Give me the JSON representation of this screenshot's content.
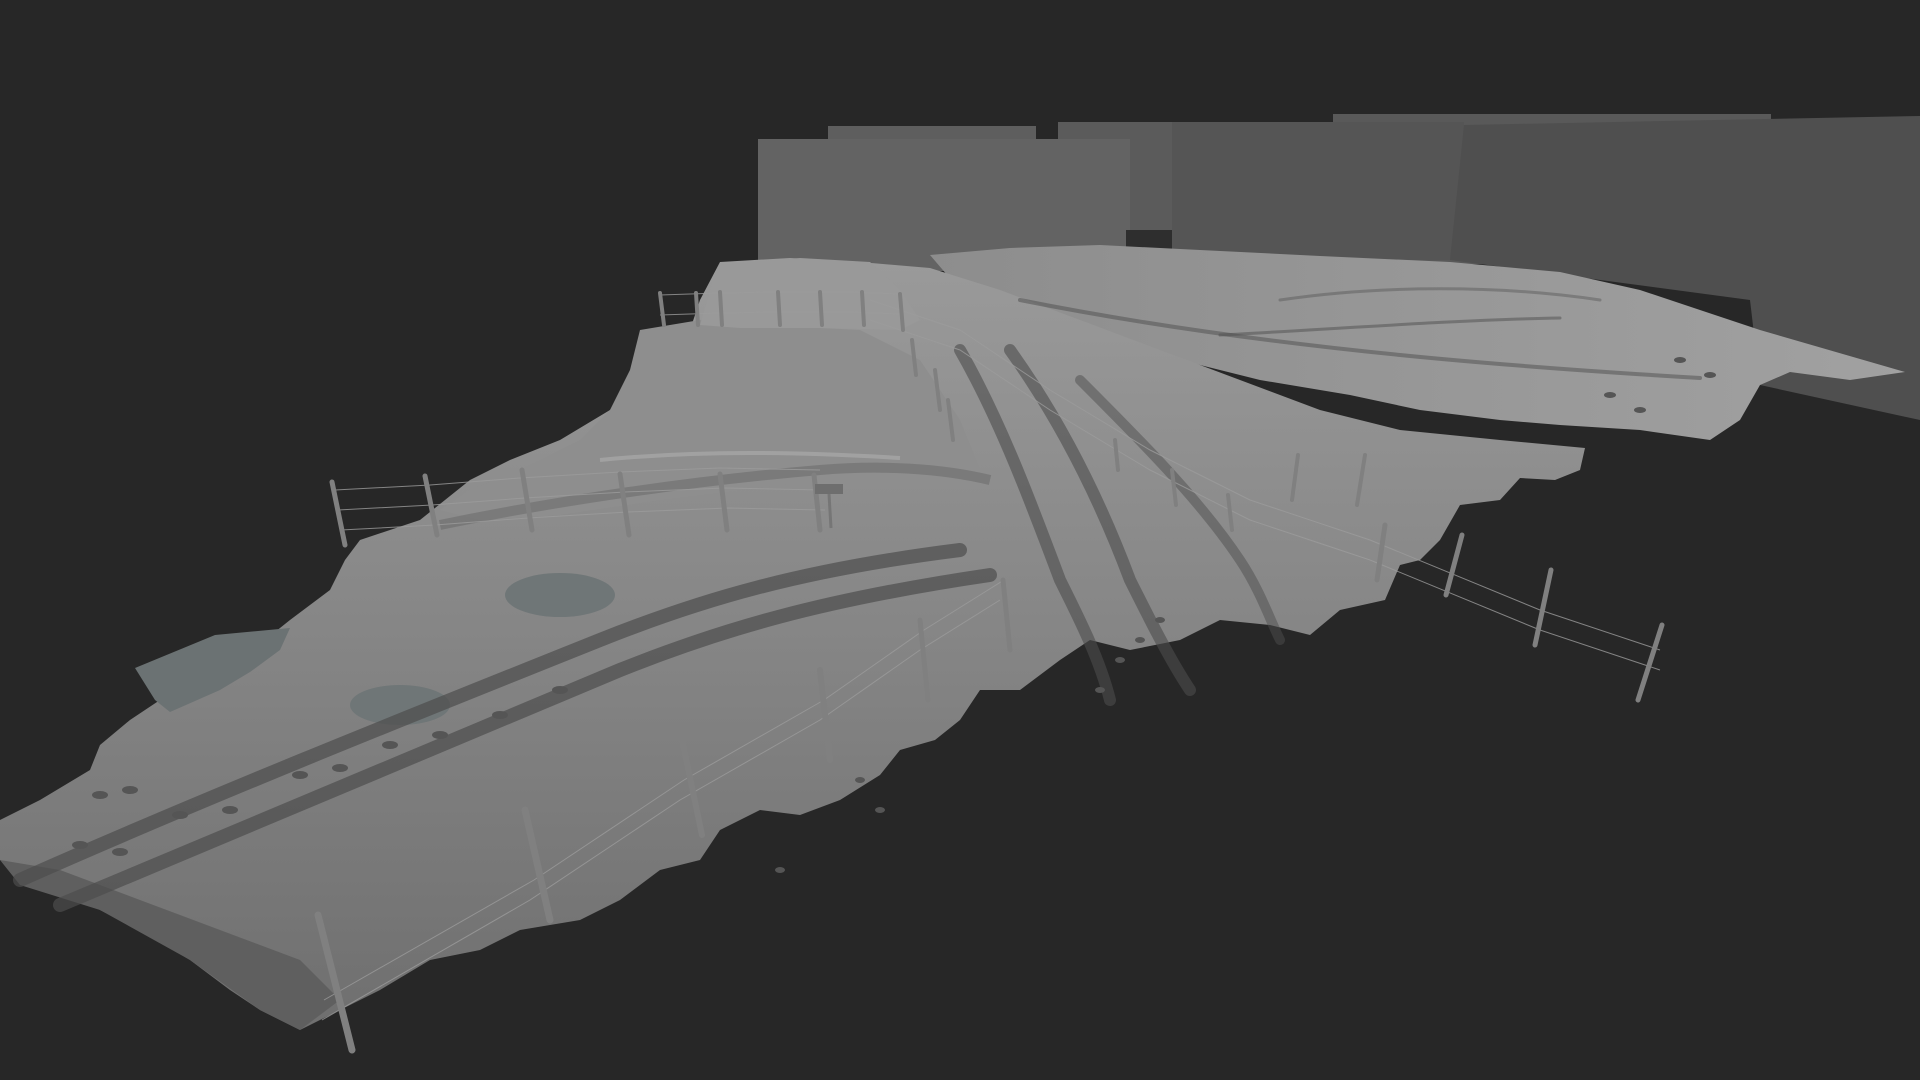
{
  "scene": {
    "background_color": "#272727",
    "terrain_color": "#8a8a8a",
    "terrain_shadow_color": "#5e5e5e",
    "backdrop_color": "#5c5c5c",
    "water_color": "#6d7475",
    "fence_post_color": "#7a7a7a",
    "wire_color": "#9a9a9a",
    "sign_color": "#6e6e6e",
    "objects": [
      "snowy-terrain",
      "backdrop-panels",
      "fence-posts",
      "fence-wires",
      "tire-tracks",
      "footprints",
      "water-puddles",
      "sign-board"
    ]
  }
}
